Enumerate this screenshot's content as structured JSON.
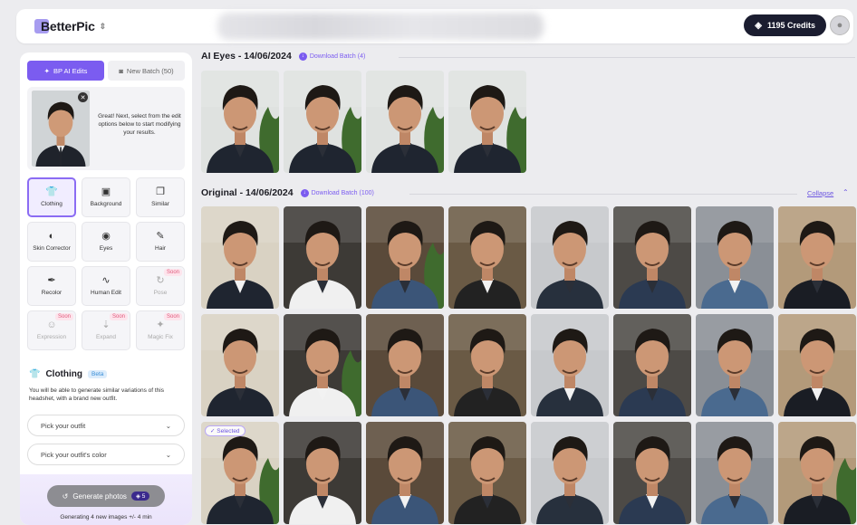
{
  "header": {
    "logo_text": "BetterPic",
    "credits_label": "1195 Credits"
  },
  "sidebar": {
    "tabs": [
      {
        "label": "BP AI Edits",
        "icon": "sparkle-icon",
        "active": true
      },
      {
        "label": "New Batch (50)",
        "icon": "camera-icon",
        "active": false
      }
    ],
    "preview_text": "Great! Next, select from the edit options below to start modifying your results.",
    "tools": [
      {
        "key": "clothing",
        "label": "Clothing",
        "icon": "👕",
        "selected": true,
        "disabled": false,
        "soon": ""
      },
      {
        "key": "background",
        "label": "Background",
        "icon": "▣",
        "selected": false,
        "disabled": false,
        "soon": ""
      },
      {
        "key": "similar",
        "label": "Similar",
        "icon": "❐",
        "selected": false,
        "disabled": false,
        "soon": ""
      },
      {
        "key": "skin-corrector",
        "label": "Skin Corrector",
        "icon": "◐",
        "selected": false,
        "disabled": false,
        "soon": ""
      },
      {
        "key": "eyes",
        "label": "Eyes",
        "icon": "◉",
        "selected": false,
        "disabled": false,
        "soon": ""
      },
      {
        "key": "hair",
        "label": "Hair",
        "icon": "✎",
        "selected": false,
        "disabled": false,
        "soon": ""
      },
      {
        "key": "recolor",
        "label": "Recolor",
        "icon": "✒",
        "selected": false,
        "disabled": false,
        "soon": ""
      },
      {
        "key": "human-edit",
        "label": "Human Edit",
        "icon": "∿",
        "selected": false,
        "disabled": false,
        "soon": ""
      },
      {
        "key": "pose",
        "label": "Pose",
        "icon": "↻",
        "selected": false,
        "disabled": true,
        "soon": "Soon"
      },
      {
        "key": "expression",
        "label": "Expression",
        "icon": "☺",
        "selected": false,
        "disabled": true,
        "soon": "Soon"
      },
      {
        "key": "expand",
        "label": "Expand",
        "icon": "⇣",
        "selected": false,
        "disabled": true,
        "soon": "Soon"
      },
      {
        "key": "magic-fix",
        "label": "Magic Fix",
        "icon": "✦",
        "selected": false,
        "disabled": true,
        "soon": "Soon"
      }
    ],
    "clothing_title": "Clothing",
    "beta_label": "Beta",
    "clothing_desc": "You will be able to generate similar variations of this headshet, with a brand new outfit.",
    "outfit_placeholder": "Pick your outfit",
    "color_placeholder": "Pick your outfit's color",
    "generate_label": "Generate photos",
    "generate_cost": "5",
    "generate_note": "Generating 4 new images +/- 4 min"
  },
  "main": {
    "ai_section": {
      "title": "AI Eyes - 14/06/2024",
      "download_label": "Download Batch (4)"
    },
    "original_section": {
      "title": "Original - 14/06/2024",
      "download_label": "Download Batch (100)",
      "collapse_label": "Collapse"
    },
    "selected_label": "Selected"
  },
  "colors": {
    "accent": "#7b5cf0",
    "header_dark": "#1b1d30",
    "soon_pink": "#e05a7c"
  }
}
